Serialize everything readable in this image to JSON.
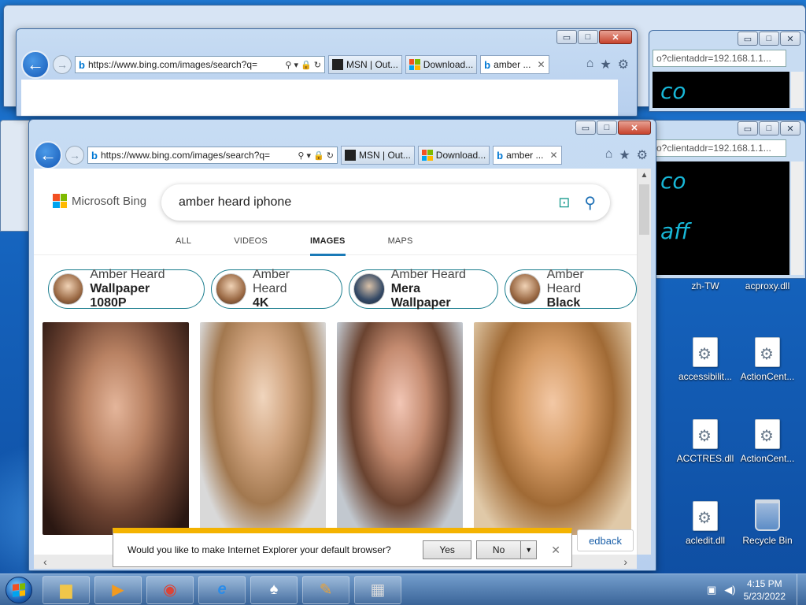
{
  "browser": {
    "url": "https://www.bing.com/images/search?q=",
    "tabs": [
      {
        "label": "MSN | Out..."
      },
      {
        "label": "Download..."
      },
      {
        "label": "amber ..."
      }
    ],
    "caption": {
      "min": "▭",
      "max": "□",
      "close": "✕"
    }
  },
  "bing": {
    "brand": "Microsoft Bing",
    "query": "amber heard iphone",
    "scopes": [
      "ALL",
      "VIDEOS",
      "IMAGES",
      "MAPS"
    ],
    "chips": [
      {
        "line1": "Amber Heard",
        "line2": "Wallpaper 1080P"
      },
      {
        "line1": "Amber Heard",
        "line2": "4K"
      },
      {
        "line1": "Amber Heard",
        "line2": "Mera Wallpaper"
      },
      {
        "line1": "Amber Heard",
        "line2": "Black"
      }
    ],
    "feedback": "edback"
  },
  "notification": {
    "message": "Would you like to make Internet Explorer your default browser?",
    "yes": "Yes",
    "no": "No"
  },
  "console": {
    "address": "o?clientaddr=192.168.1.1...",
    "text1": "co",
    "text2": "aff"
  },
  "desktop_icons": [
    {
      "label": "zh-TW"
    },
    {
      "label": "acproxy.dll"
    },
    {
      "label": "accessibilit..."
    },
    {
      "label": "ActionCent..."
    },
    {
      "label": "ACCTRES.dll"
    },
    {
      "label": "ActionCent..."
    },
    {
      "label": "acledit.dll"
    },
    {
      "label": "Recycle Bin"
    }
  ],
  "taskbar": {
    "time": "4:15 PM",
    "date": "5/23/2022"
  },
  "colors": {
    "accent": "#1a7ab7",
    "notify_bar": "#f4b300",
    "console_text": "#18b8d8"
  }
}
